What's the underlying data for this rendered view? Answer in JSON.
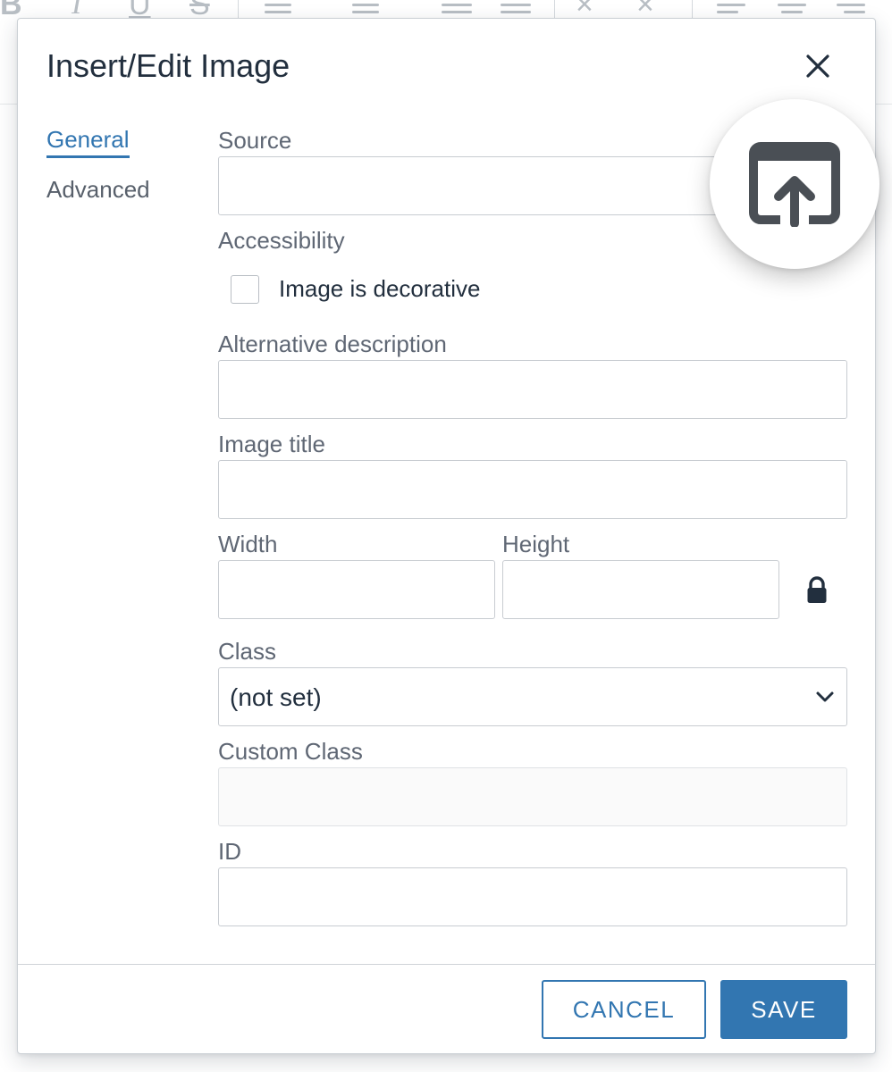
{
  "dialog": {
    "title": "Insert/Edit Image",
    "close_icon": "close-icon"
  },
  "tabs": [
    {
      "label": "General",
      "active": true
    },
    {
      "label": "Advanced",
      "active": false
    }
  ],
  "fields": {
    "source": {
      "label": "Source",
      "value": "",
      "placeholder": ""
    },
    "accessibility": {
      "label": "Accessibility"
    },
    "decorative": {
      "label": "Image is decorative",
      "checked": false
    },
    "alt": {
      "label": "Alternative description",
      "value": "",
      "placeholder": ""
    },
    "title": {
      "label": "Image title",
      "value": "",
      "placeholder": ""
    },
    "width": {
      "label": "Width",
      "value": "",
      "placeholder": ""
    },
    "height": {
      "label": "Height",
      "value": "",
      "placeholder": ""
    },
    "class": {
      "label": "Class",
      "value": "(not set)"
    },
    "custom_class": {
      "label": "Custom Class",
      "value": "",
      "placeholder": ""
    },
    "id": {
      "label": "ID",
      "value": "",
      "placeholder": ""
    }
  },
  "icons": {
    "upload": "upload-icon",
    "lock": "lock-icon",
    "chevron": "chevron-down-icon"
  },
  "footer": {
    "cancel_label": "CANCEL",
    "save_label": "SAVE"
  },
  "colors": {
    "accent": "#3276b1",
    "text": "#222f3e",
    "label": "#5f6774"
  }
}
